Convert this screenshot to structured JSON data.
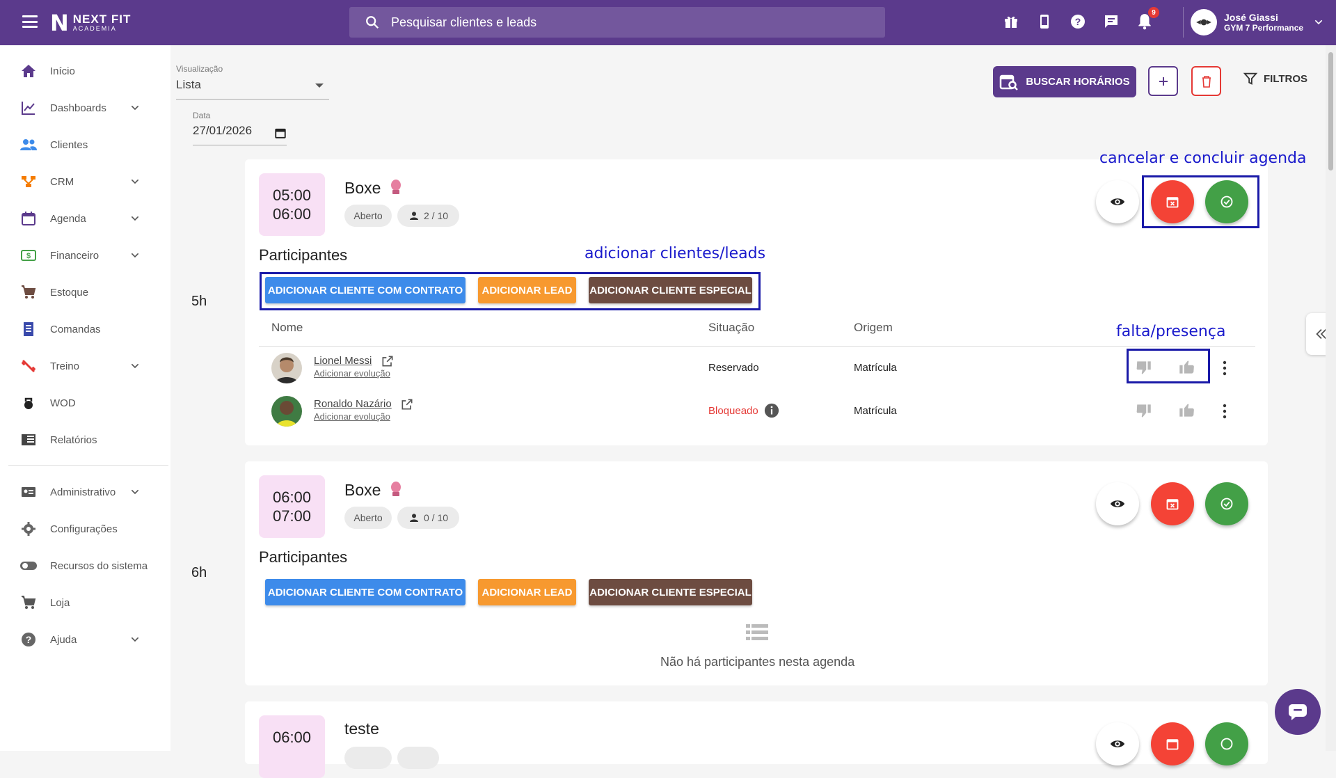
{
  "app": {
    "brand_line1": "NEXT FIT",
    "brand_line2": "ACADEMIA"
  },
  "search": {
    "placeholder": "Pesquisar clientes e leads"
  },
  "notifications": {
    "count": "9"
  },
  "user": {
    "name": "José Giassi",
    "gym": "GYM 7 Performance"
  },
  "sidebar": {
    "items": [
      {
        "label": "Início"
      },
      {
        "label": "Dashboards"
      },
      {
        "label": "Clientes"
      },
      {
        "label": "CRM"
      },
      {
        "label": "Agenda"
      },
      {
        "label": "Financeiro"
      },
      {
        "label": "Estoque"
      },
      {
        "label": "Comandas"
      },
      {
        "label": "Treino"
      },
      {
        "label": "WOD"
      },
      {
        "label": "Relatórios"
      },
      {
        "label": "Administrativo"
      },
      {
        "label": "Configurações"
      },
      {
        "label": "Recursos do sistema"
      },
      {
        "label": "Loja"
      },
      {
        "label": "Ajuda"
      }
    ]
  },
  "filters": {
    "view_label": "Visualização",
    "view_value": "Lista",
    "date_label": "Data",
    "date_value": "27/01/2026",
    "buscar_label": "BUSCAR HORÁRIOS",
    "filtros_label": "FILTROS"
  },
  "annotations": {
    "cancel_conclude": "cancelar e concluir agenda",
    "add_clients": "adicionar clientes/leads",
    "attendance": "falta/presença"
  },
  "table_headers": {
    "name": "Nome",
    "status": "Situação",
    "origin": "Origem"
  },
  "buttons": {
    "add_contract": "ADICIONAR CLIENTE COM CONTRATO",
    "add_lead": "ADICIONAR LEAD",
    "add_special": "ADICIONAR CLIENTE ESPECIAL"
  },
  "schedules": [
    {
      "hour_label": "5h",
      "start": "05:00",
      "end": "06:00",
      "title": "Boxe",
      "status": "Aberto",
      "capacity": "2 / 10",
      "participants_title": "Participantes",
      "participants": [
        {
          "name": "Lionel Messi",
          "sub": "Adicionar evolução",
          "status": "Reservado",
          "origin": "Matrícula"
        },
        {
          "name": "Ronaldo Nazário",
          "sub": "Adicionar evolução",
          "status": "Bloqueado",
          "origin": "Matrícula"
        }
      ]
    },
    {
      "hour_label": "6h",
      "start": "06:00",
      "end": "07:00",
      "title": "Boxe",
      "status": "Aberto",
      "capacity": "0 / 10",
      "participants_title": "Participantes",
      "empty_text": "Não há participantes nesta agenda"
    },
    {
      "start": "06:00",
      "title": "teste"
    }
  ],
  "colors": {
    "brand": "#5b3a8c",
    "blue_btn": "#3d8bea",
    "orange_btn": "#f7992f",
    "brown_btn": "#6d4c41",
    "red": "#f44336",
    "green": "#43a047",
    "annotation": "#1a1acc"
  }
}
